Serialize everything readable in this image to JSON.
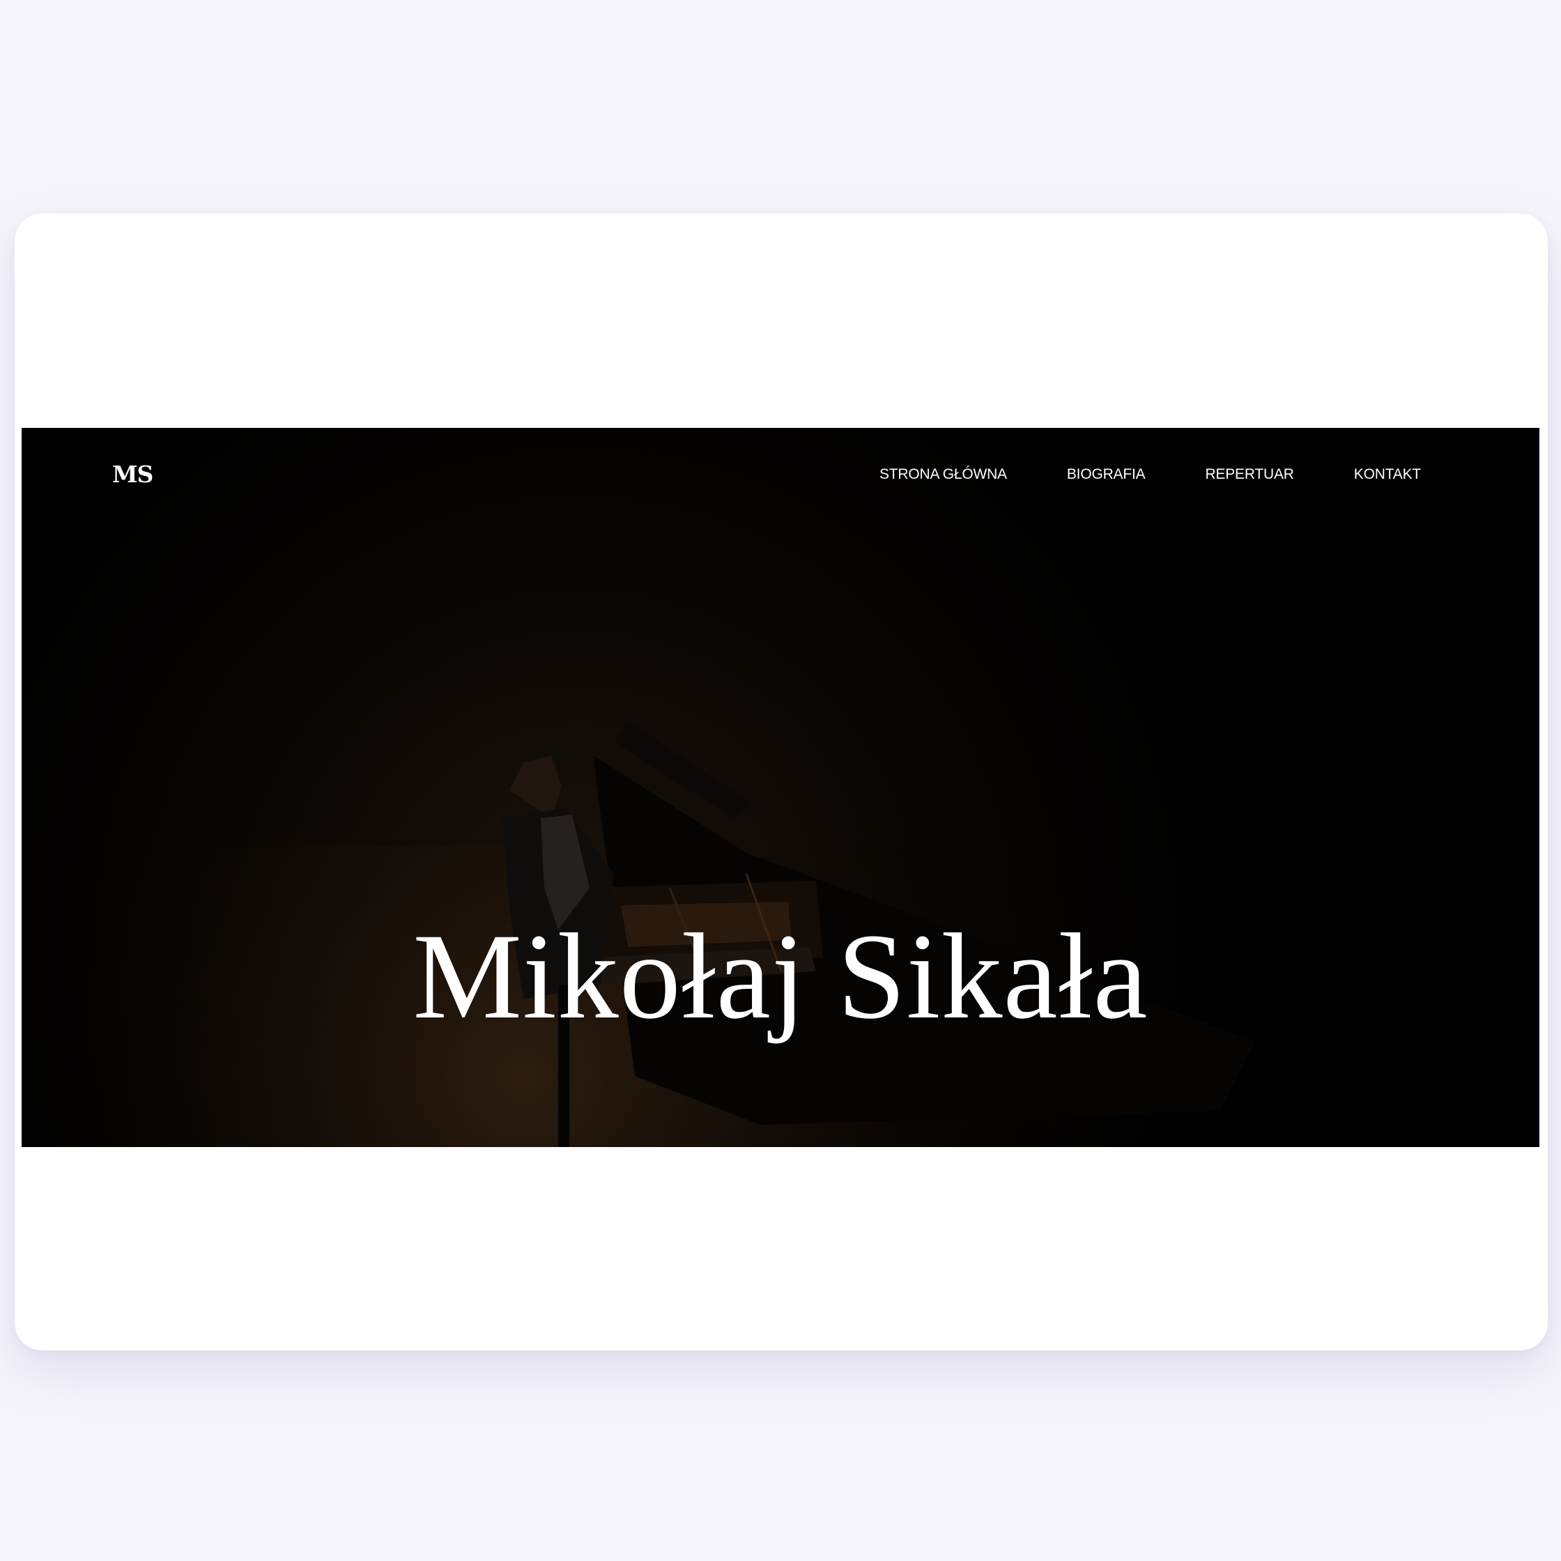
{
  "site": {
    "logo": "MS",
    "nav": [
      {
        "label": "STRONA GŁÓWNA"
      },
      {
        "label": "BIOGRAFIA"
      },
      {
        "label": "REPERTUAR"
      },
      {
        "label": "KONTAKT"
      }
    ]
  },
  "hero": {
    "title": "Mikołaj Sikała",
    "image_subject": "pianist-at-grand-piano-photo"
  },
  "colors": {
    "page_background": "#f6f5fc",
    "card_background": "#ffffff",
    "hero_background": "#000000",
    "hero_text": "#ffffff"
  }
}
